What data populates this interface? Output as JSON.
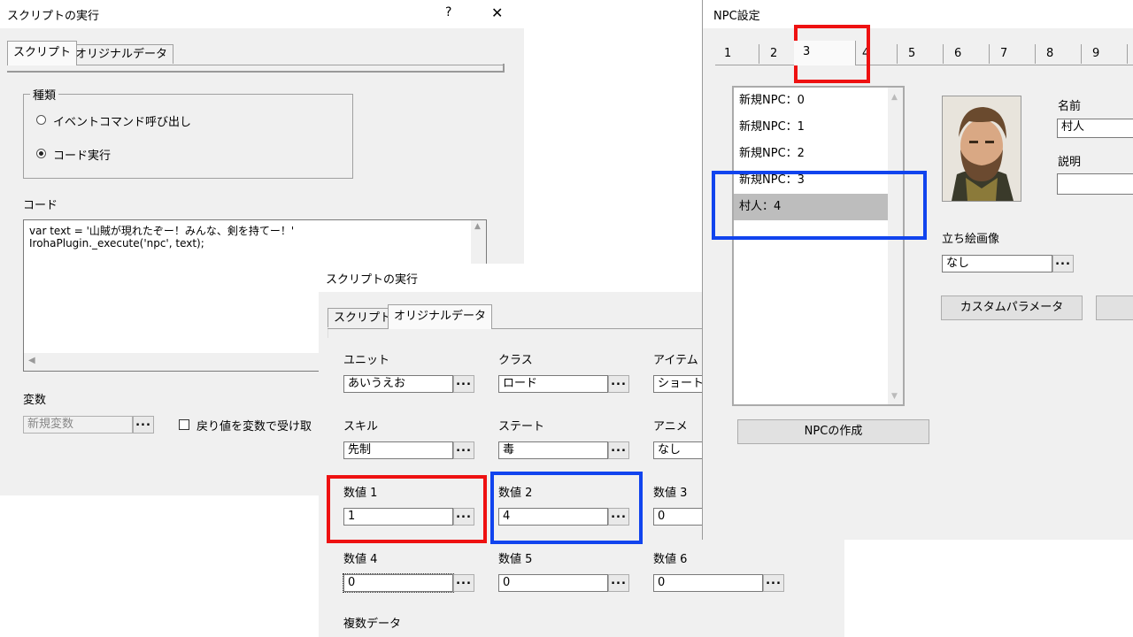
{
  "win1": {
    "title": "スクリプトの実行",
    "help_glyph": "?",
    "close_glyph": "✕",
    "tabs": [
      "スクリプト",
      "オリジナルデータ"
    ],
    "group_label": "種類",
    "radio_event": "イベントコマンド呼び出し",
    "radio_code": "コード実行",
    "code_label": "コード",
    "code_line1": "var text = '山賊が現れたぞー！みんな、剣を持てー！'",
    "code_line2": "IrohaPlugin._execute('npc', text);",
    "var_label": "変数",
    "var_value": "新規変数",
    "checkbox_label": "戻り値を変数で受け取"
  },
  "win2": {
    "title": "スクリプトの実行",
    "tabs": [
      "スクリプト",
      "オリジナルデータ"
    ],
    "fields": [
      {
        "label": "ユニット",
        "value": "あいうえお"
      },
      {
        "label": "クラス",
        "value": "ロード"
      },
      {
        "label": "アイテム",
        "value": "ショートソ"
      },
      {
        "label": "スキル",
        "value": "先制"
      },
      {
        "label": "ステート",
        "value": "毒"
      },
      {
        "label": "アニメ",
        "value": "なし"
      },
      {
        "label": "数値 1",
        "value": "1"
      },
      {
        "label": "数値 2",
        "value": "4"
      },
      {
        "label": "数値 3",
        "value": "0"
      },
      {
        "label": "数値 4",
        "value": "0"
      },
      {
        "label": "数値 5",
        "value": "0"
      },
      {
        "label": "数値 6",
        "value": "0"
      }
    ],
    "multi_label": "複数データ",
    "dots": "..."
  },
  "win3": {
    "title": "NPC設定",
    "tabs": [
      "1",
      "2",
      "3",
      "4",
      "5",
      "6",
      "7",
      "8",
      "9"
    ],
    "list": [
      "新規NPC：0",
      "新規NPC：1",
      "新規NPC：2",
      "新規NPC：3",
      "村人：4"
    ],
    "create_button": "NPCの作成",
    "name_label": "名前",
    "name_value": "村人",
    "desc_label": "説明",
    "desc_value": "",
    "image_label": "立ち絵画像",
    "image_value": "なし",
    "custom_button": "カスタムパラメータ"
  },
  "colors": {
    "highlight_red": "#ee1111",
    "highlight_blue": "#1144ee",
    "selected_row": "#bdbdbd"
  }
}
